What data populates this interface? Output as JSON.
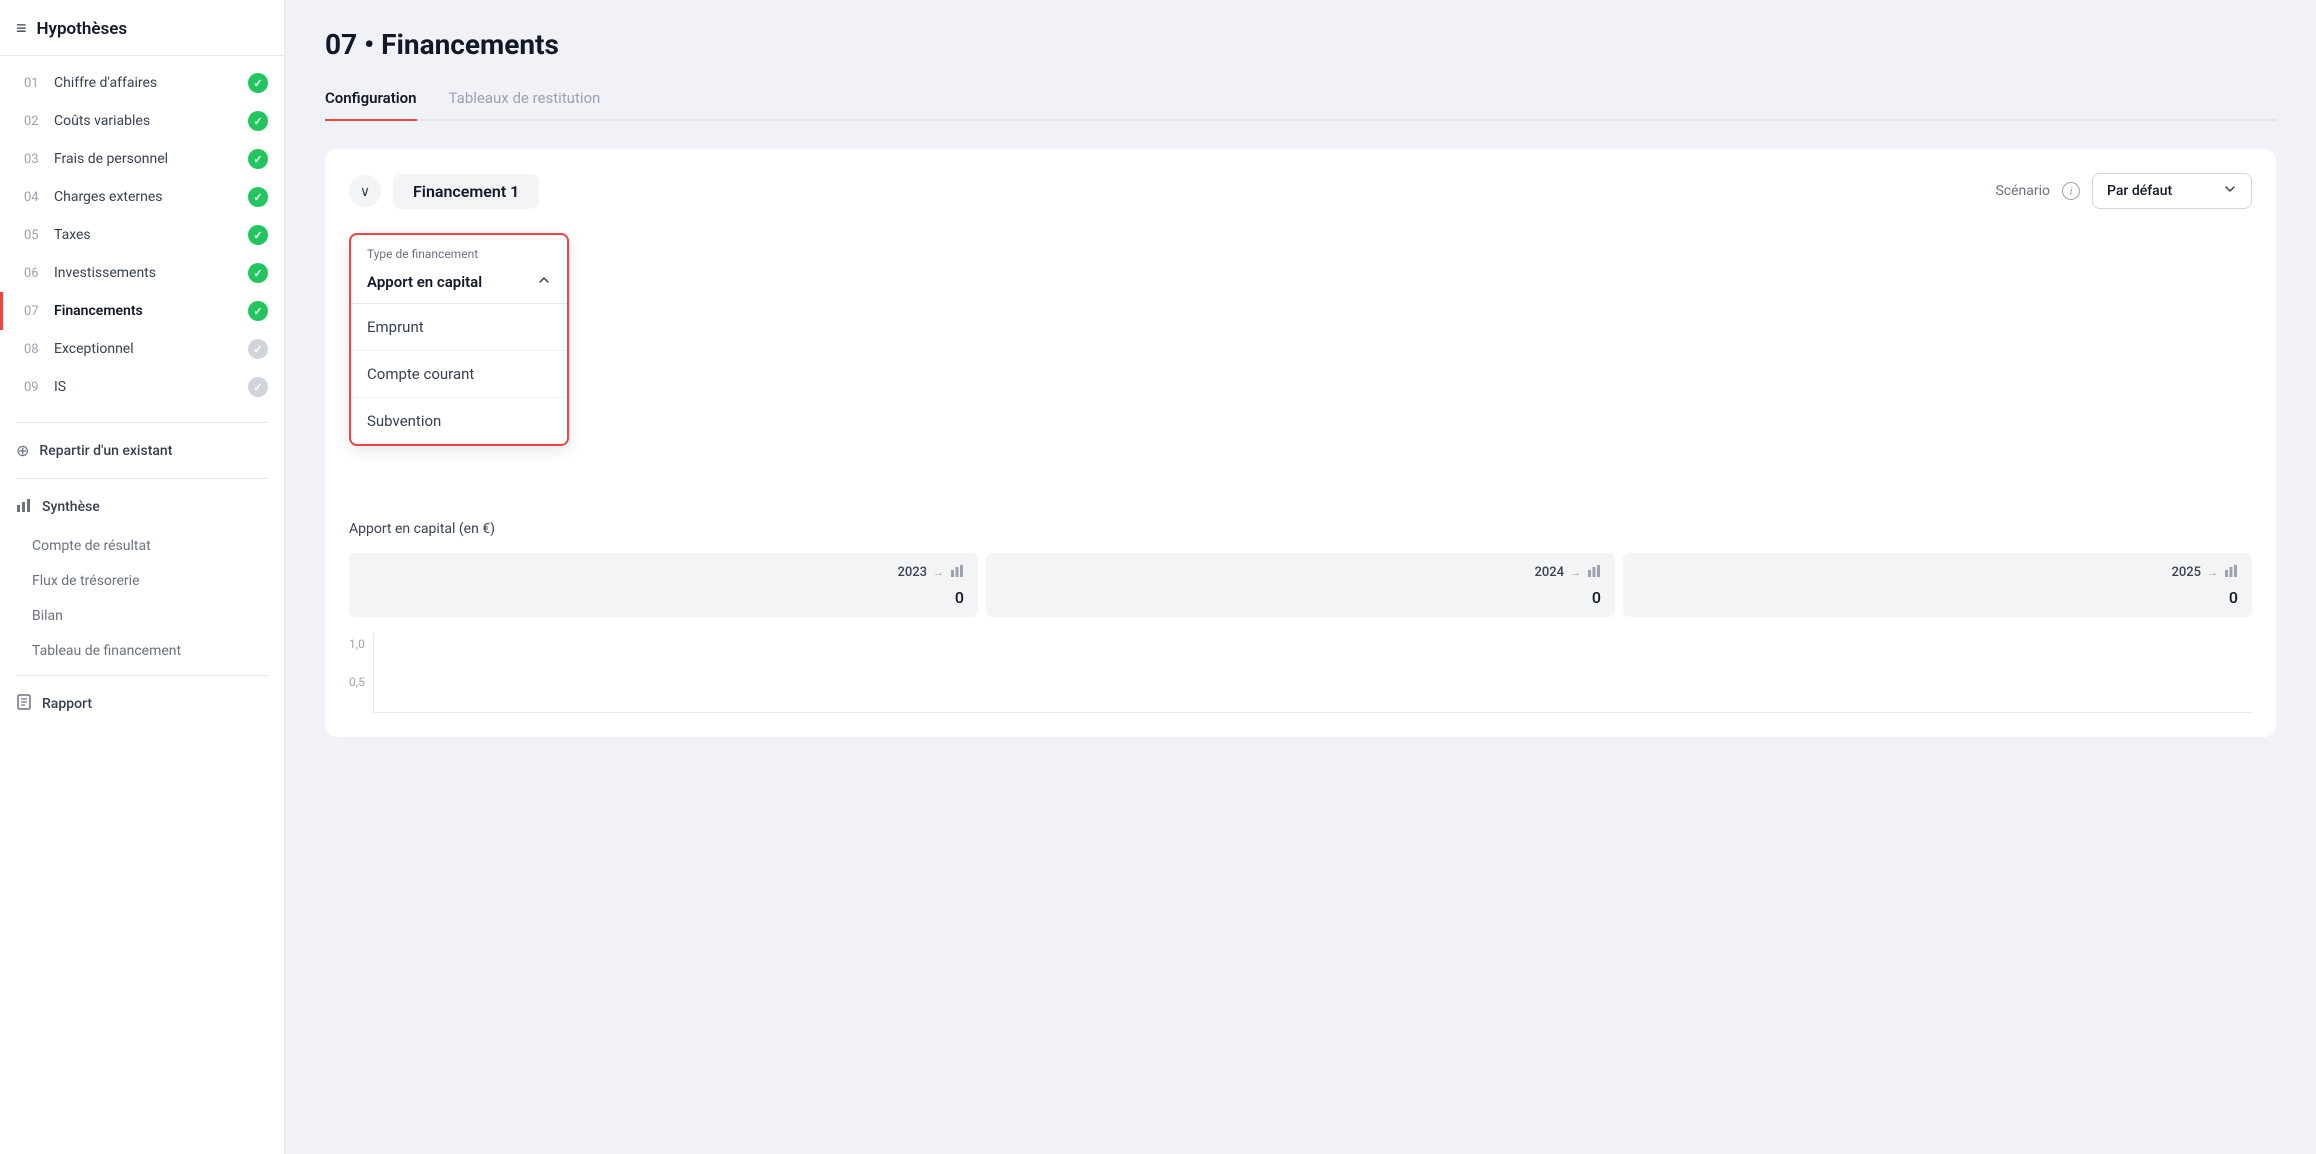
{
  "sidebar": {
    "header": {
      "icon": "≡",
      "title": "Hypothèses"
    },
    "items": [
      {
        "num": "01",
        "label": "Chiffre d'affaires",
        "status": "green"
      },
      {
        "num": "02",
        "label": "Coûts variables",
        "status": "green"
      },
      {
        "num": "03",
        "label": "Frais de personnel",
        "status": "green"
      },
      {
        "num": "04",
        "label": "Charges externes",
        "status": "green"
      },
      {
        "num": "05",
        "label": "Taxes",
        "status": "green"
      },
      {
        "num": "06",
        "label": "Investissements",
        "status": "green"
      },
      {
        "num": "07",
        "label": "Financements",
        "status": "green",
        "active": true
      },
      {
        "num": "08",
        "label": "Exceptionnel",
        "status": "gray"
      },
      {
        "num": "09",
        "label": "IS",
        "status": "gray"
      }
    ],
    "groups": [
      {
        "icon": "⊕",
        "label": "Repartir d'un existant"
      },
      {
        "icon": "📊",
        "label": "Synthèse",
        "sub_items": [
          "Compte de résultat",
          "Flux de trésorerie",
          "Bilan",
          "Tableau de financement"
        ]
      },
      {
        "icon": "≡",
        "label": "Rapport"
      }
    ]
  },
  "page": {
    "title": "07 • Financements",
    "tabs": [
      {
        "label": "Configuration",
        "active": true
      },
      {
        "label": "Tableaux de restitution",
        "active": false
      }
    ]
  },
  "card": {
    "collapse_icon": "∨",
    "financement_label": "Financement 1",
    "scenario_label": "Scénario",
    "scenario_info": "i",
    "scenario_value": "Par défaut",
    "scenario_chevron": "∨"
  },
  "dropdown": {
    "header_label": "Type de financement",
    "selected_value": "Apport en capital",
    "chevron_up": "∧",
    "options": [
      {
        "label": "Emprunt"
      },
      {
        "label": "Compte courant"
      },
      {
        "label": "Subvention"
      }
    ]
  },
  "content": {
    "section_title": "Apport en capital (en €)",
    "years": [
      {
        "label": "2023",
        "arrow": "→",
        "value": "0"
      },
      {
        "label": "2024",
        "arrow": "→",
        "value": "0"
      },
      {
        "label": "2025",
        "arrow": "→",
        "value": "0"
      }
    ],
    "chart": {
      "y_labels": [
        "1,0",
        "0,5"
      ]
    }
  }
}
